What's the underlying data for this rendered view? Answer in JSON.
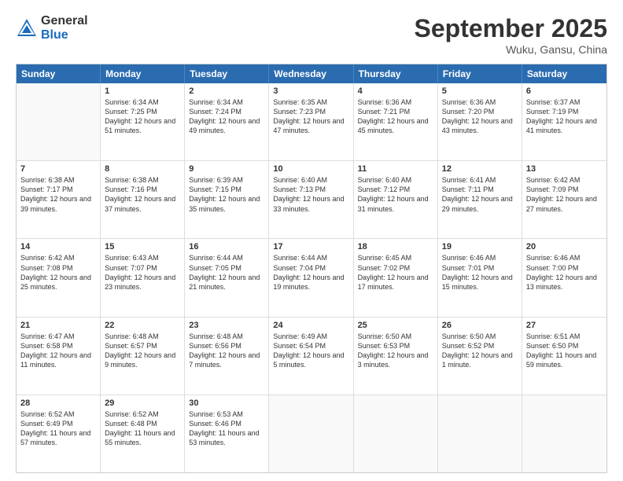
{
  "logo": {
    "general": "General",
    "blue": "Blue"
  },
  "title": "September 2025",
  "location": "Wuku, Gansu, China",
  "header_days": [
    "Sunday",
    "Monday",
    "Tuesday",
    "Wednesday",
    "Thursday",
    "Friday",
    "Saturday"
  ],
  "weeks": [
    [
      {
        "day": "",
        "sunrise": "",
        "sunset": "",
        "daylight": ""
      },
      {
        "day": "1",
        "sunrise": "Sunrise: 6:34 AM",
        "sunset": "Sunset: 7:25 PM",
        "daylight": "Daylight: 12 hours and 51 minutes."
      },
      {
        "day": "2",
        "sunrise": "Sunrise: 6:34 AM",
        "sunset": "Sunset: 7:24 PM",
        "daylight": "Daylight: 12 hours and 49 minutes."
      },
      {
        "day": "3",
        "sunrise": "Sunrise: 6:35 AM",
        "sunset": "Sunset: 7:23 PM",
        "daylight": "Daylight: 12 hours and 47 minutes."
      },
      {
        "day": "4",
        "sunrise": "Sunrise: 6:36 AM",
        "sunset": "Sunset: 7:21 PM",
        "daylight": "Daylight: 12 hours and 45 minutes."
      },
      {
        "day": "5",
        "sunrise": "Sunrise: 6:36 AM",
        "sunset": "Sunset: 7:20 PM",
        "daylight": "Daylight: 12 hours and 43 minutes."
      },
      {
        "day": "6",
        "sunrise": "Sunrise: 6:37 AM",
        "sunset": "Sunset: 7:19 PM",
        "daylight": "Daylight: 12 hours and 41 minutes."
      }
    ],
    [
      {
        "day": "7",
        "sunrise": "Sunrise: 6:38 AM",
        "sunset": "Sunset: 7:17 PM",
        "daylight": "Daylight: 12 hours and 39 minutes."
      },
      {
        "day": "8",
        "sunrise": "Sunrise: 6:38 AM",
        "sunset": "Sunset: 7:16 PM",
        "daylight": "Daylight: 12 hours and 37 minutes."
      },
      {
        "day": "9",
        "sunrise": "Sunrise: 6:39 AM",
        "sunset": "Sunset: 7:15 PM",
        "daylight": "Daylight: 12 hours and 35 minutes."
      },
      {
        "day": "10",
        "sunrise": "Sunrise: 6:40 AM",
        "sunset": "Sunset: 7:13 PM",
        "daylight": "Daylight: 12 hours and 33 minutes."
      },
      {
        "day": "11",
        "sunrise": "Sunrise: 6:40 AM",
        "sunset": "Sunset: 7:12 PM",
        "daylight": "Daylight: 12 hours and 31 minutes."
      },
      {
        "day": "12",
        "sunrise": "Sunrise: 6:41 AM",
        "sunset": "Sunset: 7:11 PM",
        "daylight": "Daylight: 12 hours and 29 minutes."
      },
      {
        "day": "13",
        "sunrise": "Sunrise: 6:42 AM",
        "sunset": "Sunset: 7:09 PM",
        "daylight": "Daylight: 12 hours and 27 minutes."
      }
    ],
    [
      {
        "day": "14",
        "sunrise": "Sunrise: 6:42 AM",
        "sunset": "Sunset: 7:08 PM",
        "daylight": "Daylight: 12 hours and 25 minutes."
      },
      {
        "day": "15",
        "sunrise": "Sunrise: 6:43 AM",
        "sunset": "Sunset: 7:07 PM",
        "daylight": "Daylight: 12 hours and 23 minutes."
      },
      {
        "day": "16",
        "sunrise": "Sunrise: 6:44 AM",
        "sunset": "Sunset: 7:05 PM",
        "daylight": "Daylight: 12 hours and 21 minutes."
      },
      {
        "day": "17",
        "sunrise": "Sunrise: 6:44 AM",
        "sunset": "Sunset: 7:04 PM",
        "daylight": "Daylight: 12 hours and 19 minutes."
      },
      {
        "day": "18",
        "sunrise": "Sunrise: 6:45 AM",
        "sunset": "Sunset: 7:02 PM",
        "daylight": "Daylight: 12 hours and 17 minutes."
      },
      {
        "day": "19",
        "sunrise": "Sunrise: 6:46 AM",
        "sunset": "Sunset: 7:01 PM",
        "daylight": "Daylight: 12 hours and 15 minutes."
      },
      {
        "day": "20",
        "sunrise": "Sunrise: 6:46 AM",
        "sunset": "Sunset: 7:00 PM",
        "daylight": "Daylight: 12 hours and 13 minutes."
      }
    ],
    [
      {
        "day": "21",
        "sunrise": "Sunrise: 6:47 AM",
        "sunset": "Sunset: 6:58 PM",
        "daylight": "Daylight: 12 hours and 11 minutes."
      },
      {
        "day": "22",
        "sunrise": "Sunrise: 6:48 AM",
        "sunset": "Sunset: 6:57 PM",
        "daylight": "Daylight: 12 hours and 9 minutes."
      },
      {
        "day": "23",
        "sunrise": "Sunrise: 6:48 AM",
        "sunset": "Sunset: 6:56 PM",
        "daylight": "Daylight: 12 hours and 7 minutes."
      },
      {
        "day": "24",
        "sunrise": "Sunrise: 6:49 AM",
        "sunset": "Sunset: 6:54 PM",
        "daylight": "Daylight: 12 hours and 5 minutes."
      },
      {
        "day": "25",
        "sunrise": "Sunrise: 6:50 AM",
        "sunset": "Sunset: 6:53 PM",
        "daylight": "Daylight: 12 hours and 3 minutes."
      },
      {
        "day": "26",
        "sunrise": "Sunrise: 6:50 AM",
        "sunset": "Sunset: 6:52 PM",
        "daylight": "Daylight: 12 hours and 1 minute."
      },
      {
        "day": "27",
        "sunrise": "Sunrise: 6:51 AM",
        "sunset": "Sunset: 6:50 PM",
        "daylight": "Daylight: 11 hours and 59 minutes."
      }
    ],
    [
      {
        "day": "28",
        "sunrise": "Sunrise: 6:52 AM",
        "sunset": "Sunset: 6:49 PM",
        "daylight": "Daylight: 11 hours and 57 minutes."
      },
      {
        "day": "29",
        "sunrise": "Sunrise: 6:52 AM",
        "sunset": "Sunset: 6:48 PM",
        "daylight": "Daylight: 11 hours and 55 minutes."
      },
      {
        "day": "30",
        "sunrise": "Sunrise: 6:53 AM",
        "sunset": "Sunset: 6:46 PM",
        "daylight": "Daylight: 11 hours and 53 minutes."
      },
      {
        "day": "",
        "sunrise": "",
        "sunset": "",
        "daylight": ""
      },
      {
        "day": "",
        "sunrise": "",
        "sunset": "",
        "daylight": ""
      },
      {
        "day": "",
        "sunrise": "",
        "sunset": "",
        "daylight": ""
      },
      {
        "day": "",
        "sunrise": "",
        "sunset": "",
        "daylight": ""
      }
    ]
  ]
}
